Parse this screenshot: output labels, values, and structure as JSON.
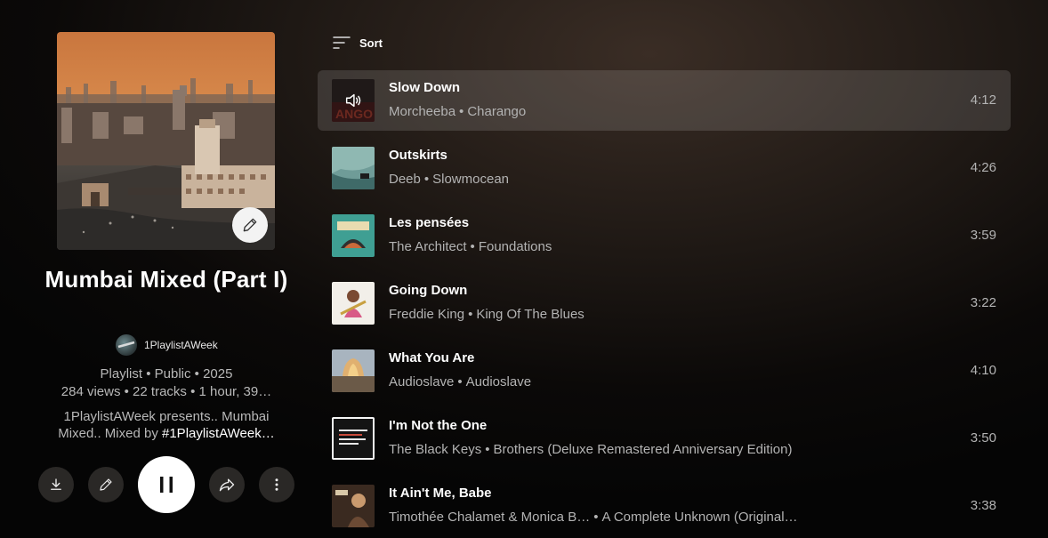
{
  "playlist": {
    "title": "Mumbai Mixed (Part I)",
    "owner": "1PlaylistAWeek",
    "meta_line1": "Playlist • Public • 2025",
    "meta_line2": "284 views • 22 tracks • 1 hour, 39…",
    "description_line1": "1PlaylistAWeek presents.. Mumbai",
    "description_line2_prefix": "Mixed.. Mixed by ",
    "description_hashtag": "#1PlaylistAWeek…"
  },
  "actions": {
    "download_icon": "download-icon",
    "edit_icon": "pencil-icon",
    "play_state": "pause-icon",
    "share_icon": "share-icon",
    "more_icon": "more-vert-icon"
  },
  "sort": {
    "label": "Sort",
    "icon": "sort-icon"
  },
  "tracks": [
    {
      "title": "Slow Down",
      "artist": "Morcheeba",
      "album": "Charango",
      "duration": "4:12",
      "active": true
    },
    {
      "title": "Outskirts",
      "artist": "Deeb",
      "album": "Slowmocean",
      "duration": "4:26",
      "active": false
    },
    {
      "title": "Les pensées",
      "artist": "The Architect",
      "album": "Foundations",
      "duration": "3:59",
      "active": false
    },
    {
      "title": "Going Down",
      "artist": "Freddie King",
      "album": "King Of The Blues",
      "duration": "3:22",
      "active": false
    },
    {
      "title": "What You Are",
      "artist": "Audioslave",
      "album": "Audioslave",
      "duration": "4:10",
      "active": false
    },
    {
      "title": "I'm Not the One",
      "artist": "The Black Keys",
      "album": "Brothers (Deluxe Remastered Anniversary Edition)",
      "duration": "3:50",
      "active": false
    },
    {
      "title": "It Ain't Me, Babe",
      "artist": "Timothée Chalamet & Monica B…",
      "album": "A Complete Unknown (Original…",
      "duration": "3:38",
      "active": false
    }
  ],
  "colors": {
    "background_top": "#3a2d25",
    "background_bottom": "#050505",
    "active_row": "#3b3632",
    "text_primary": "#ffffff",
    "text_secondary": "#b3b3b3"
  }
}
